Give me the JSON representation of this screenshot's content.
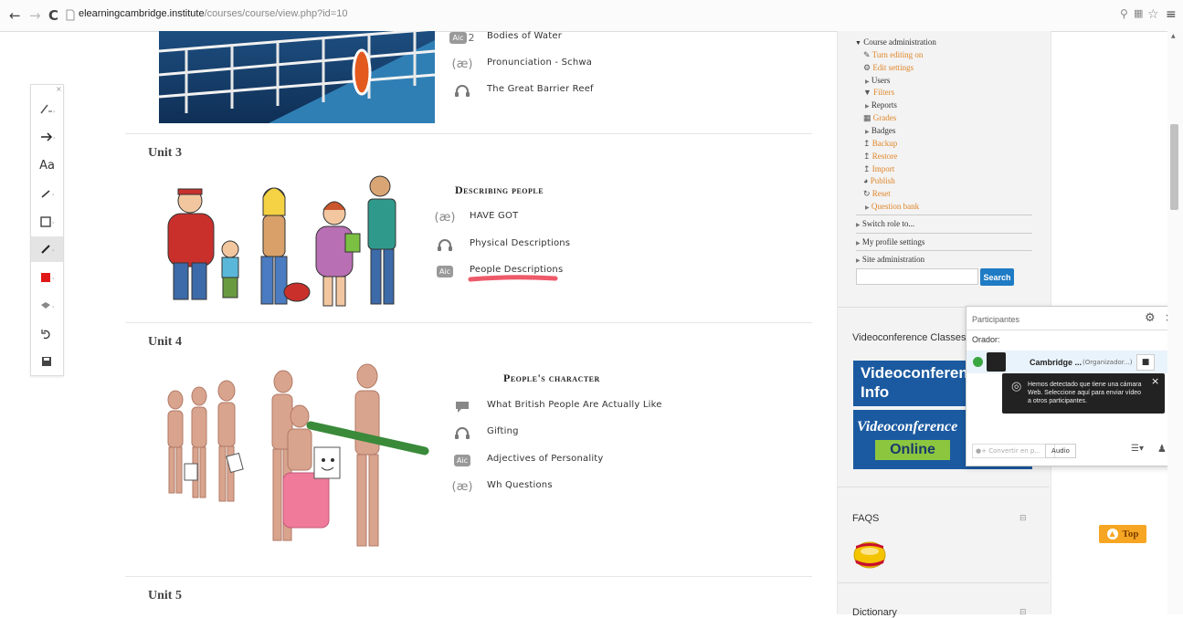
{
  "browser": {
    "url_domain": "elearningcambridge.institute",
    "url_path": "/courses/course/view.php?id=10"
  },
  "palette": {
    "tools": [
      "pen-arrow-tool",
      "arrow-tool",
      "text-tool",
      "line-tool",
      "rectangle-tool",
      "pencil-tool",
      "color-tool",
      "fill-tool",
      "undo-tool",
      "save-tool"
    ],
    "text_tool_label": "Aa",
    "color": "#e01818"
  },
  "units": [
    {
      "label": "Unit 3",
      "lesson_title": "Describing people",
      "activities": [
        {
          "icon": "ae",
          "label": "HAVE GOT"
        },
        {
          "icon": "headphones",
          "label": "Physical Descriptions"
        },
        {
          "icon": "abc",
          "label": "People Descriptions"
        }
      ]
    },
    {
      "label": "Unit 4",
      "lesson_title": "People's character",
      "activities": [
        {
          "icon": "chat",
          "label": "What British People Are Actually Like"
        },
        {
          "icon": "headphones",
          "label": "Gifting"
        },
        {
          "icon": "abc",
          "label": "Adjectives of Personality"
        },
        {
          "icon": "ae",
          "label": "Wh Questions"
        }
      ]
    },
    {
      "label": "Unit 5"
    }
  ],
  "prev_unit_activities": [
    {
      "icon": "abc",
      "label": "Bodies of Water",
      "prefix": "2"
    },
    {
      "icon": "ae",
      "label": "Pronunciation - Schwa"
    },
    {
      "icon": "headphones",
      "label": "The Great Barrier Reef"
    }
  ],
  "icon_text": {
    "ae": "(æ)",
    "abc": "Aic"
  },
  "admin": {
    "header": "Course administration",
    "items": [
      {
        "label": "Turn editing on",
        "link": true
      },
      {
        "label": "Edit settings",
        "link": true
      },
      {
        "label": "Users",
        "link": false
      },
      {
        "label": "Filters",
        "link": true
      },
      {
        "label": "Reports",
        "link": false
      },
      {
        "label": "Grades",
        "link": true
      },
      {
        "label": "Badges",
        "link": false
      },
      {
        "label": "Backup",
        "link": true
      },
      {
        "label": "Restore",
        "link": true
      },
      {
        "label": "Import",
        "link": true
      },
      {
        "label": "Publish",
        "link": true
      },
      {
        "label": "Reset",
        "link": true
      },
      {
        "label": "Question bank",
        "link": true
      }
    ],
    "switch_role": "Switch role to...",
    "profile": "My profile settings",
    "site_admin": "Site administration",
    "search_button": "Search"
  },
  "videoconf": {
    "title": "Videoconference Classes",
    "banner1_line1": "Videoconferen",
    "banner1_line2": "Info",
    "banner2_line1": "Videoconference",
    "banner2_line2": "Online"
  },
  "faqs": "FAQS",
  "dictionary": "Dictionary",
  "top_button": "Top",
  "participants": {
    "title": "Participantes",
    "speaker_label": "Orador:",
    "name": "Cambridge ...",
    "role": "(Organizador...)",
    "tooltip": "Hemos detectado que tiene una cámara Web. Seleccione aquí para enviar vídeo a otros participantes.",
    "convert_placeholder": "Convertir en p...",
    "audio_button": "Audio"
  },
  "colors": {
    "accent_orange": "#e0862a",
    "search_blue": "#1e7bc4",
    "banner_blue": "#1b5aa0",
    "online_green": "#8cc63f",
    "annotation_red": "#ee5a6a"
  }
}
